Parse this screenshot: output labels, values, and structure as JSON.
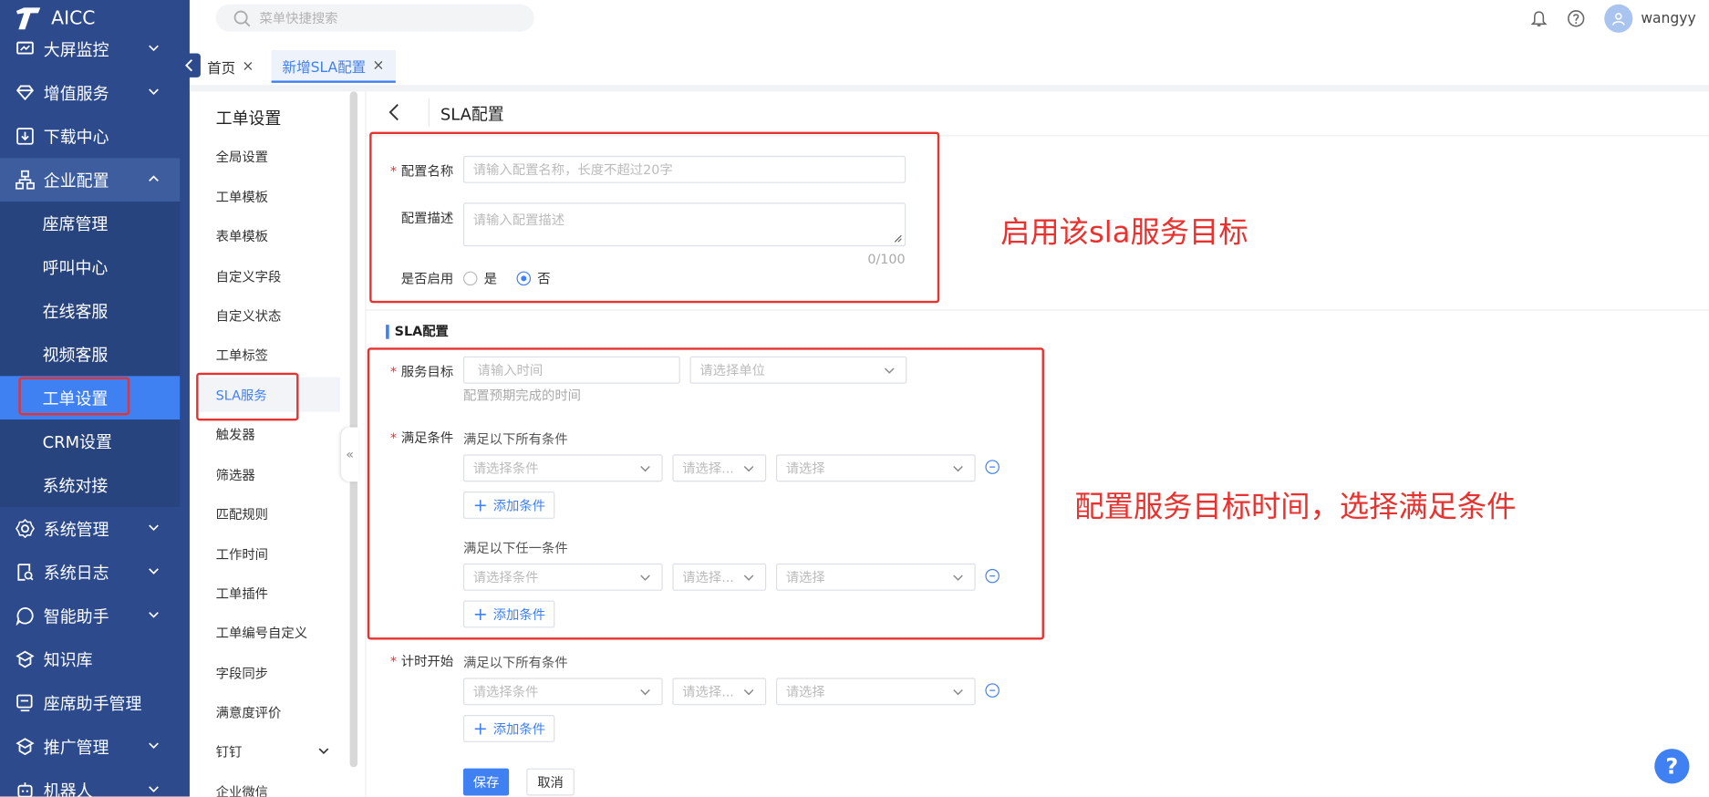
{
  "app": {
    "name": "AICC"
  },
  "sidebar": {
    "partial_item": {
      "label": "大屏监控",
      "icon": "monitor-icon"
    },
    "items": [
      {
        "label": "增值服务",
        "icon": "diamond-icon",
        "has_chevron": true
      },
      {
        "label": "下载中心",
        "icon": "download-icon",
        "has_chevron": false
      },
      {
        "label": "企业配置",
        "icon": "org-icon",
        "has_chevron": true,
        "expanded": true
      },
      {
        "label": "系统管理",
        "icon": "gear-icon",
        "has_chevron": true
      },
      {
        "label": "系统日志",
        "icon": "log-icon",
        "has_chevron": true
      },
      {
        "label": "智能助手",
        "icon": "chat-icon",
        "has_chevron": true
      },
      {
        "label": "知识库",
        "icon": "knowledge-icon",
        "has_chevron": false
      },
      {
        "label": "座席助手管理",
        "icon": "assistant-icon",
        "has_chevron": false
      },
      {
        "label": "推广管理",
        "icon": "promotion-icon",
        "has_chevron": true
      },
      {
        "label": "机器人",
        "icon": "robot-icon",
        "has_chevron": true
      }
    ],
    "subitems": [
      "座席管理",
      "呼叫中心",
      "在线客服",
      "视频客服",
      "工单设置",
      "CRM设置",
      "系统对接"
    ],
    "active_subitem": "工单设置"
  },
  "header": {
    "search_placeholder": "菜单快捷搜索",
    "username": "wangyy"
  },
  "tabs": [
    {
      "label": "首页",
      "active": false
    },
    {
      "label": "新增SLA配置",
      "active": true
    }
  ],
  "settings_nav": {
    "title": "工单设置",
    "items": [
      "全局设置",
      "工单模板",
      "表单模板",
      "自定义字段",
      "自定义状态",
      "工单标签",
      "SLA服务",
      "触发器",
      "筛选器",
      "匹配规则",
      "工作时间",
      "工单插件",
      "工单编号自定义",
      "字段同步",
      "满意度评价",
      "钉钉",
      "企业微信"
    ],
    "active": "SLA服务"
  },
  "form": {
    "page_title": "SLA配置",
    "name_label": "配置名称",
    "name_placeholder": "请输入配置名称，长度不超过20字",
    "desc_label": "配置描述",
    "desc_placeholder": "请输入配置描述",
    "desc_counter": "0/100",
    "enable_label": "是否启用",
    "enable_yes": "是",
    "enable_no": "否",
    "enabled": false,
    "section_title": "SLA配置",
    "target_label": "服务目标",
    "target_time_placeholder": "请输入时间",
    "target_unit_placeholder": "请选择单位",
    "target_hint": "配置预期完成的时间",
    "condition_label": "满足条件",
    "all_conditions": "满足以下所有条件",
    "any_condition": "满足以下任一条件",
    "cond_placeholder": "请选择条件",
    "op_placeholder": "请选择...",
    "value_placeholder": "请选择",
    "add_condition": "添加条件",
    "timer_label": "计时开始",
    "timer_conditions": "满足以下所有条件",
    "save": "保存",
    "cancel": "取消"
  },
  "annotations": {
    "note1": "启用该sla服务目标",
    "note2": "配置服务目标时间，选择满足条件"
  },
  "colors": {
    "sidebar_bg": "#2c4a8c",
    "active_blue": "#3f80f2",
    "annotation_red": "#e8322f"
  }
}
